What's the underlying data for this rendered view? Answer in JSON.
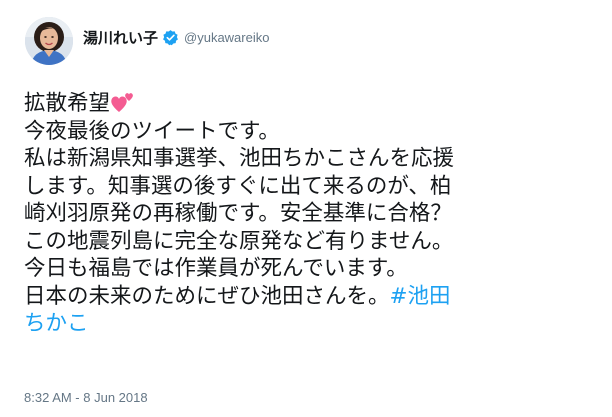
{
  "author": {
    "display_name": "湯川れい子",
    "handle": "@yukawareiko",
    "verified": true,
    "avatar": "profile-photo"
  },
  "tweet": {
    "lines": [
      "拡散希望",
      "今夜最後のツイートです。",
      "私は新潟県知事選挙、池田ちかこさんを応援",
      "します。知事選の後すぐに出て来るのが、柏",
      "崎刈羽原発の再稼働です。安全基準に合格？",
      "この地震列島に完全な原発など有りません。",
      "今日も福島では作業員が死んでいます。",
      "日本の未来のためにぜひ池田さんを。"
    ],
    "hashtag_line1": "#池田",
    "hashtag_line2": "ちかこ",
    "emoji": "two-hearts-icon"
  },
  "timestamp": "8:32 AM - 8 Jun 2018",
  "colors": {
    "text": "#14171a",
    "secondary": "#657786",
    "link": "#1da1f2",
    "verified": "#1da1f2",
    "heart": "#f45c92"
  }
}
